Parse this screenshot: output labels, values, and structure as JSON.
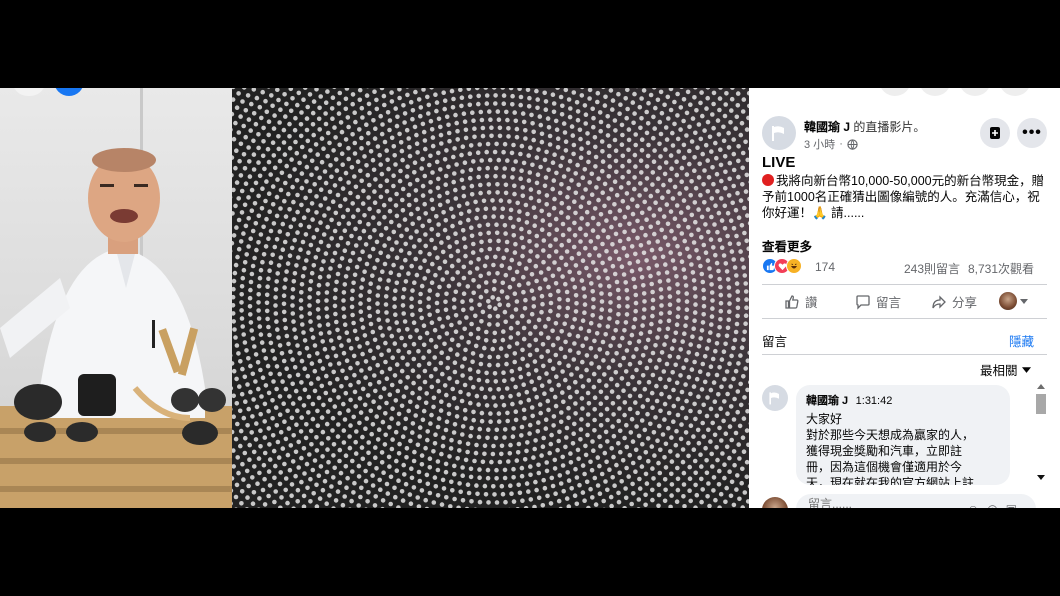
{
  "post": {
    "author": "韓國瑜 J",
    "author_suffix": "的直播影片。",
    "time": "3 小時",
    "live_label": "LIVE",
    "body": "我將向新台幣10,000-50,000元的新台幣現金，贈予前1000名正確猜出圖像編號的人。充滿信心，祝你好運！🙏 請......",
    "see_more": "查看更多"
  },
  "stats": {
    "reaction_count": "174",
    "comments": "243則留言",
    "views": "8,731次觀看"
  },
  "actions": {
    "like": "讚",
    "comment": "留言",
    "share": "分享"
  },
  "comments_section": {
    "label": "留言",
    "hide": "隱藏",
    "sort": "最相關"
  },
  "comment": {
    "author": "韓國瑜 J",
    "time": "1:31:42",
    "text": "大家好\n對於那些今天想成為贏家的人，\n獲得現金獎勵和汽車，立即註\n冊，因為這個機會僅適用於今\n天，現在就在我的官方網站上註"
  },
  "composer": {
    "placeholder": "留言......"
  },
  "icons": {
    "privacy": "globe-icon",
    "save": "bookmark-plus-icon",
    "more": "more-icon",
    "like": "thumbs-up-icon",
    "comment": "speech-bubble-icon",
    "share": "share-arrow-icon",
    "sort": "caret-down-icon"
  },
  "colors": {
    "facebook_blue": "#1877f2",
    "live_red": "#e02020",
    "love": "#f33e58",
    "haha": "#f7b125"
  }
}
